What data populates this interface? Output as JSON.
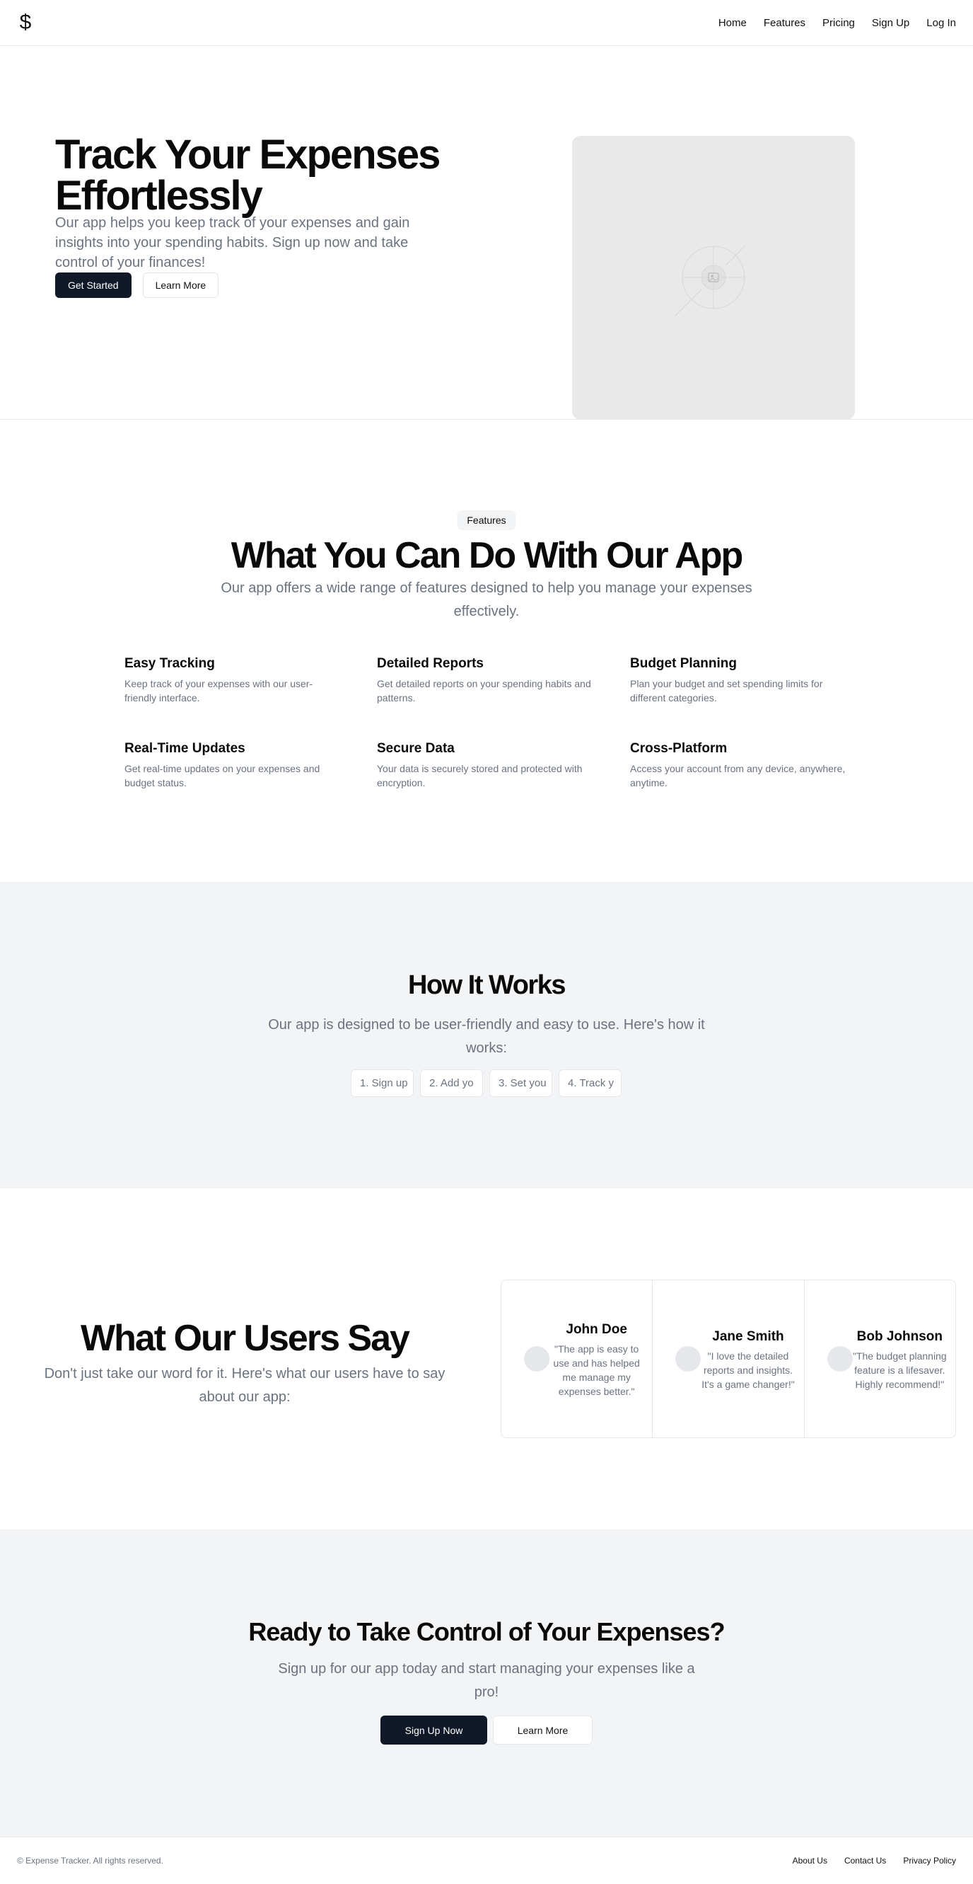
{
  "header": {
    "logo": "$",
    "nav": [
      "Home",
      "Features",
      "Pricing",
      "Sign Up",
      "Log In"
    ]
  },
  "hero": {
    "title": "Track Your Expenses Effortlessly",
    "subtitle": "Our app helps you keep track of your expenses and gain insights into your spending habits. Sign up now and take control of your finances!",
    "primary_button": "Get Started",
    "secondary_button": "Learn More",
    "image_icon": "image-placeholder-icon"
  },
  "features": {
    "badge": "Features",
    "title": "What You Can Do With Our App",
    "subtitle": "Our app offers a wide range of features designed to help you manage your expenses effectively.",
    "items": [
      {
        "title": "Easy Tracking",
        "description": "Keep track of your expenses with our user-friendly interface."
      },
      {
        "title": "Detailed Reports",
        "description": "Get detailed reports on your spending habits and patterns."
      },
      {
        "title": "Budget Planning",
        "description": "Plan your budget and set spending limits for different categories."
      },
      {
        "title": "Real-Time Updates",
        "description": "Get real-time updates on your expenses and budget status."
      },
      {
        "title": "Secure Data",
        "description": "Your data is securely stored and protected with encryption."
      },
      {
        "title": "Cross-Platform",
        "description": "Access your account from any device, anywhere, anytime."
      }
    ]
  },
  "how": {
    "title": "How It Works",
    "subtitle": "Our app is designed to be user-friendly and easy to use. Here's how it works:",
    "steps": [
      "1. Sign up",
      "2. Add yo",
      "3. Set you",
      "4. Track y"
    ]
  },
  "testimonials": {
    "title": "What Our Users Say",
    "subtitle": "Don't just take our word for it. Here's what our users have to say about our app:",
    "items": [
      {
        "name": "John Doe",
        "quote": "\"The app is easy to use and has helped me manage my expenses better.\""
      },
      {
        "name": "Jane Smith",
        "quote": "\"I love the detailed reports and insights. It's a game changer!\""
      },
      {
        "name": "Bob Johnson",
        "quote": "\"The budget planning feature is a lifesaver. Highly recommend!\""
      }
    ]
  },
  "cta": {
    "title": "Ready to Take Control of Your Expenses?",
    "subtitle": "Sign up for our app today and start managing your expenses like a pro!",
    "primary_button": "Sign Up Now",
    "secondary_button": "Learn More"
  },
  "footer": {
    "copyright": "© Expense Tracker. All rights reserved.",
    "links": [
      "About Us",
      "Contact Us",
      "Privacy Policy"
    ]
  },
  "colors": {
    "primary": "#111827",
    "muted_text": "#6b7280",
    "section_bg": "#f3f4f6",
    "border": "#e5e7eb"
  }
}
